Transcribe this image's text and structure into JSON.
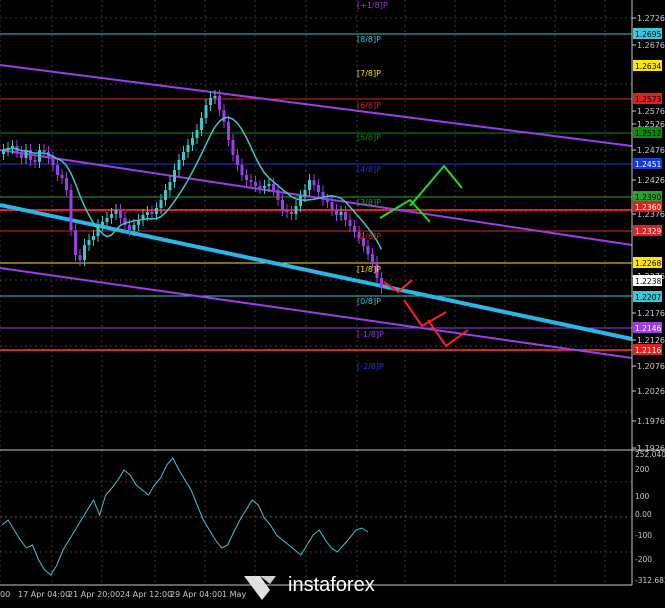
{
  "chart": {
    "price_scale": [
      "1.2726",
      "1.2676",
      "1.2576",
      "1.2526",
      "1.2476",
      "1.2426",
      "1.2376",
      "1.2276",
      "1.2176",
      "1.2126",
      "1.2076",
      "1.2026",
      "1.1976",
      "1.1926"
    ],
    "tags": [
      {
        "text": "1.2695",
        "bg": "#38c8d8",
        "fg": "#000"
      },
      {
        "text": "1.2634",
        "bg": "#ffe600",
        "fg": "#000"
      },
      {
        "text": "1.2573",
        "bg": "#e02020",
        "fg": "#000"
      },
      {
        "text": "1.2512",
        "bg": "#0e8a0e",
        "fg": "#000"
      },
      {
        "text": "1.2451",
        "bg": "#1a3ad8",
        "fg": "#fff"
      },
      {
        "text": "1.2390",
        "bg": "#2aa02a",
        "fg": "#000"
      },
      {
        "text": "1.2360",
        "bg": "#e02020",
        "fg": "#fff"
      },
      {
        "text": "1.2329",
        "bg": "#e02020",
        "fg": "#fff"
      },
      {
        "text": "1.2268",
        "bg": "#ffe600",
        "fg": "#000"
      },
      {
        "text": "1.2238",
        "bg": "#ffffff",
        "fg": "#000"
      },
      {
        "text": "1.2207",
        "bg": "#38c8d8",
        "fg": "#000"
      },
      {
        "text": "1.2146",
        "bg": "#9b3ee8",
        "fg": "#fff"
      },
      {
        "text": "1.2116",
        "bg": "#e02020",
        "fg": "#fff"
      }
    ],
    "murray": [
      "[+1/8]P",
      "[8/8]P",
      "[7/8]P",
      "[6/8]P",
      "[5/8]P",
      "[4/8]P",
      "[3/8]P",
      "[2/8]P",
      "[1/8]P",
      "[0/8]P",
      "[-1/8]P",
      "[-2/8]P"
    ],
    "osc_scale": [
      "252.0403",
      "200",
      "100",
      "0.00",
      "-100",
      "-200",
      "-312.682"
    ],
    "time_labels": [
      "00",
      "17 Apr 04:00",
      "21 Apr 20:00",
      "24 Apr 12:00",
      "29 Apr 04:00",
      "1 May"
    ]
  },
  "logo": {
    "text": "instaforex"
  },
  "colors": {
    "bg": "#000000",
    "axis": "#c8c8c8",
    "grid": "#404040",
    "channel": "#9b3ee8",
    "trend": "#29b6e8",
    "ma": "#3fc7c7",
    "bull": "#3fc7c7",
    "bear": "#9b3ee8",
    "arrow_up": "#1fdc1f",
    "arrow_down": "#ff2020"
  }
}
